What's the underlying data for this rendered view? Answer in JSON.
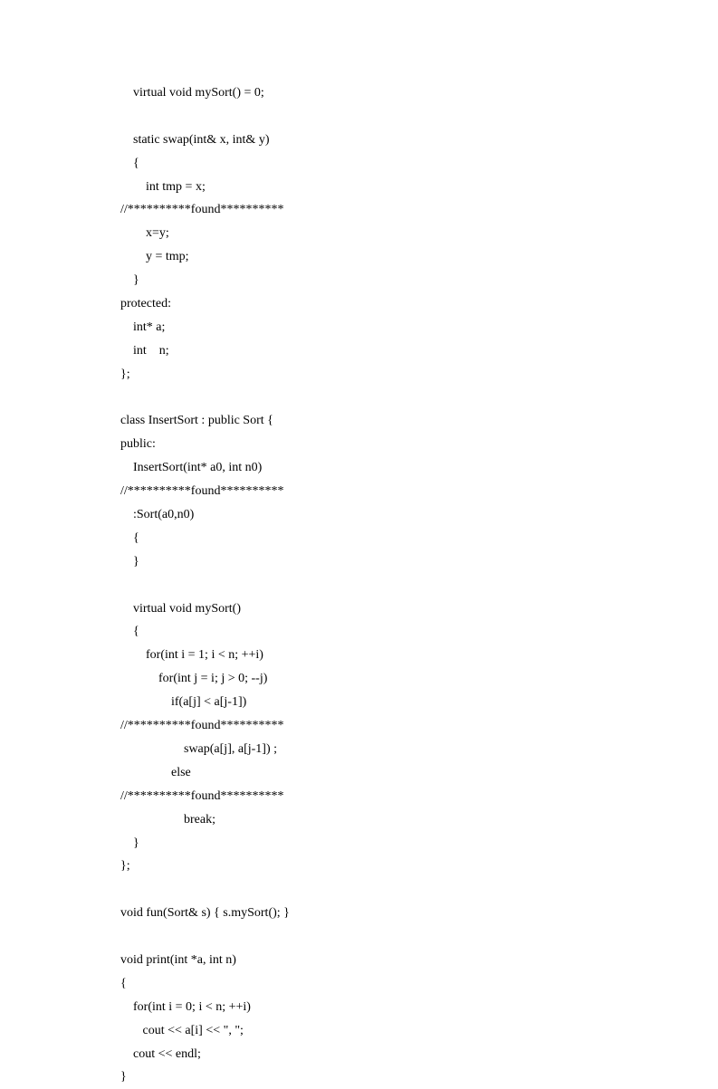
{
  "code": {
    "lines": [
      "    virtual void mySort() = 0;",
      "",
      "    static swap(int& x, int& y)",
      "    {",
      "        int tmp = x;",
      "//**********found**********",
      "        x=y;",
      "        y = tmp;",
      "    }",
      "protected:",
      "    int* a;",
      "    int    n;",
      "};",
      "",
      "class InsertSort : public Sort {",
      "public:",
      "    InsertSort(int* a0, int n0)",
      "//**********found**********",
      "    :Sort(a0,n0)",
      "    {",
      "    }",
      "",
      "    virtual void mySort()",
      "    {",
      "        for(int i = 1; i < n; ++i)",
      "            for(int j = i; j > 0; --j)",
      "                if(a[j] < a[j-1])",
      "//**********found**********",
      "                    swap(a[j], a[j-1]) ;",
      "                else",
      "//**********found**********",
      "                    break;",
      "    }",
      "};",
      "",
      "void fun(Sort& s) { s.mySort(); }",
      "",
      "void print(int *a, int n)",
      "{",
      "    for(int i = 0; i < n; ++i)",
      "       cout << a[i] << \", \";",
      "    cout << endl;",
      "}"
    ]
  }
}
